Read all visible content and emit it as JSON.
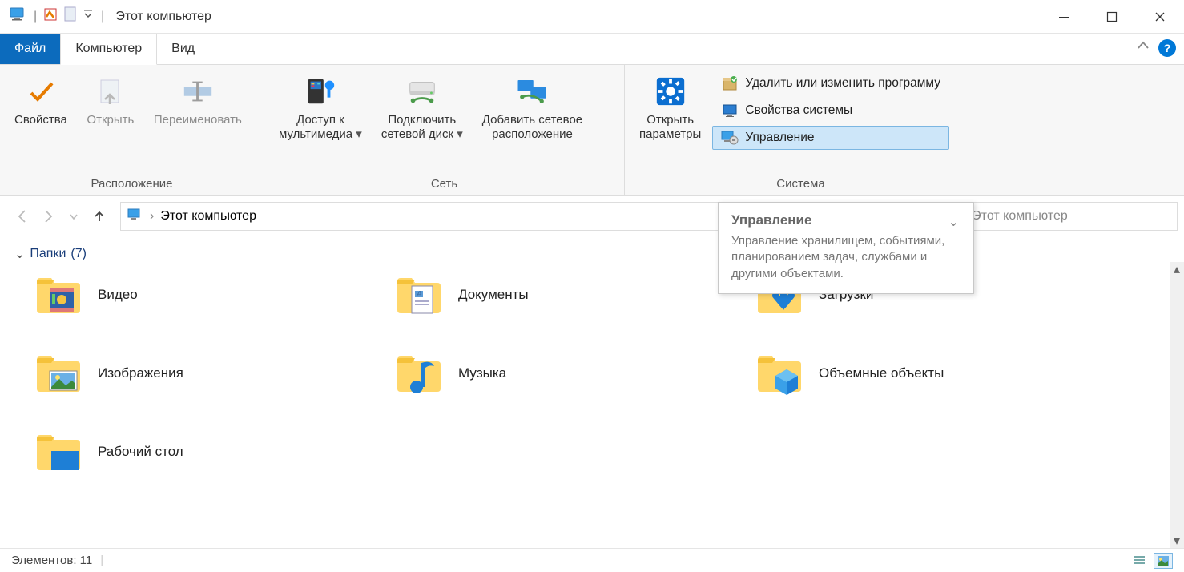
{
  "window": {
    "title": "Этот компьютер"
  },
  "tabs": {
    "file": "Файл",
    "computer": "Компьютер",
    "view": "Вид"
  },
  "ribbon": {
    "group_location": {
      "label": "Расположение",
      "properties": "Свойства",
      "open": "Открыть",
      "rename": "Переименовать"
    },
    "group_network": {
      "label": "Сеть",
      "media": "Доступ к\nмультимедиа",
      "map_drive": "Подключить\nсетевой диск",
      "add_location": "Добавить сетевое\nрасположение"
    },
    "group_system": {
      "label": "Система",
      "open_settings": "Открыть\nпараметры",
      "uninstall": "Удалить или изменить программу",
      "system_props": "Свойства системы",
      "manage": "Управление"
    }
  },
  "nav": {
    "breadcrumb": "Этот компьютер",
    "search_placeholder": "Поиск в: Этот компьютер"
  },
  "content": {
    "group_header": {
      "name": "Папки",
      "count": "(7)"
    },
    "folders": [
      {
        "label": "Видео",
        "icon": "videos"
      },
      {
        "label": "Документы",
        "icon": "documents"
      },
      {
        "label": "Загрузки",
        "icon": "downloads"
      },
      {
        "label": "Изображения",
        "icon": "pictures"
      },
      {
        "label": "Музыка",
        "icon": "music"
      },
      {
        "label": "Объемные объекты",
        "icon": "3d"
      },
      {
        "label": "Рабочий стол",
        "icon": "desktop"
      }
    ]
  },
  "tooltip": {
    "title": "Управление",
    "body": "Управление хранилищем, событиями, планированием задач, службами и другими объектами."
  },
  "status": {
    "items_label": "Элементов: 11"
  }
}
